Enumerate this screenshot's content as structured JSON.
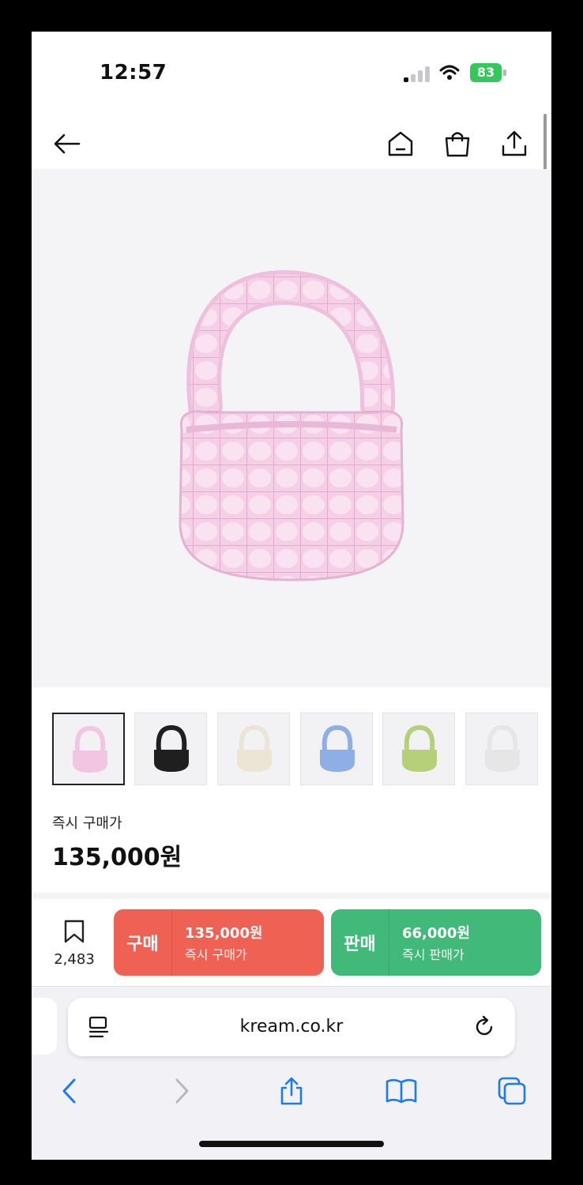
{
  "status_bar": {
    "time": "12:57",
    "battery": "83",
    "signal_icon": "cellular-signal-icon",
    "wifi_icon": "wifi-icon",
    "battery_icon": "battery-charging-icon"
  },
  "nav": {
    "back_icon": "arrow-left-icon",
    "home_icon": "home-icon",
    "cart_icon": "shopping-bag-icon",
    "share_icon": "share-icon"
  },
  "product": {
    "hero_color": "#f2c6e3",
    "thumbnails": [
      {
        "color": "#f2c6e3",
        "selected": true
      },
      {
        "color": "#1f1f1f",
        "selected": false
      },
      {
        "color": "#ece5d6",
        "selected": false
      },
      {
        "color": "#8eaee6",
        "selected": false
      },
      {
        "color": "#b6d07a",
        "selected": false
      },
      {
        "color": "#e6e6e6",
        "selected": false
      }
    ],
    "price_label": "즉시 구매가",
    "price": "135,000원"
  },
  "actions": {
    "wishlist_icon": "bookmark-icon",
    "wishlist_count": "2,483",
    "buy": {
      "label": "구매",
      "amount": "135,000원",
      "sub": "즉시 구매가",
      "color": "#ef6253"
    },
    "sell": {
      "label": "판매",
      "amount": "66,000원",
      "sub": "즉시 판매가",
      "color": "#41b979"
    }
  },
  "browser": {
    "url": "kream.co.kr",
    "reader_icon": "reader-mode-icon",
    "reload_icon": "reload-icon",
    "toolbar": {
      "back_icon": "chevron-left-icon",
      "forward_icon": "chevron-right-icon",
      "share_icon": "share-icon",
      "bookmarks_icon": "book-icon",
      "tabs_icon": "tabs-icon"
    },
    "accent": "#1a7bf2"
  }
}
